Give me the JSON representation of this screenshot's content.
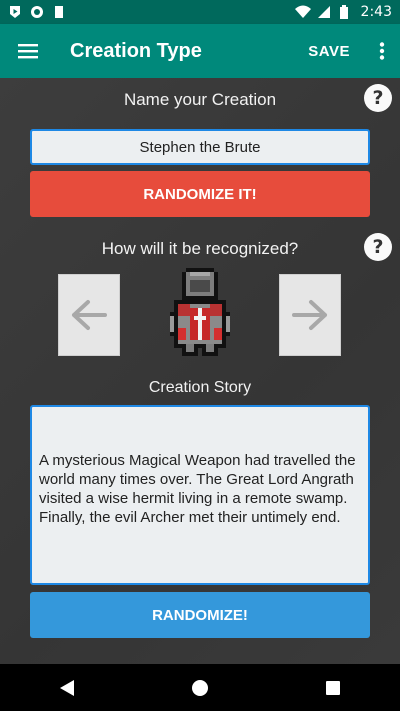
{
  "status_bar": {
    "time": "2:43",
    "left_icons": [
      "play-protect-icon",
      "record-icon",
      "sd-card-icon"
    ],
    "right_icons": [
      "wifi-icon",
      "signal-icon",
      "battery-icon"
    ]
  },
  "app_bar": {
    "title": "Creation Type",
    "save_label": "SAVE",
    "background": "#00897b"
  },
  "name_section": {
    "heading": "Name your Creation",
    "name_value": "Stephen the Brute",
    "randomize_label": "RANDOMIZE IT!"
  },
  "appearance_section": {
    "heading": "How will it be recognized?",
    "prev_icon": "arrow-left-icon",
    "next_icon": "arrow-right-icon",
    "sprite": "armored-knight-sprite"
  },
  "story_section": {
    "heading": "Creation Story",
    "story_text": "A mysterious Magical Weapon had travelled the world many times over. The Great Lord Angrath visited a wise hermit living in a remote swamp. Finally, the evil Archer met their untimely end.",
    "randomize_label": "RANDOMIZE!"
  },
  "colors": {
    "accent_red": "#e74c3c",
    "accent_blue": "#3498db",
    "status_bar": "#00695c"
  }
}
